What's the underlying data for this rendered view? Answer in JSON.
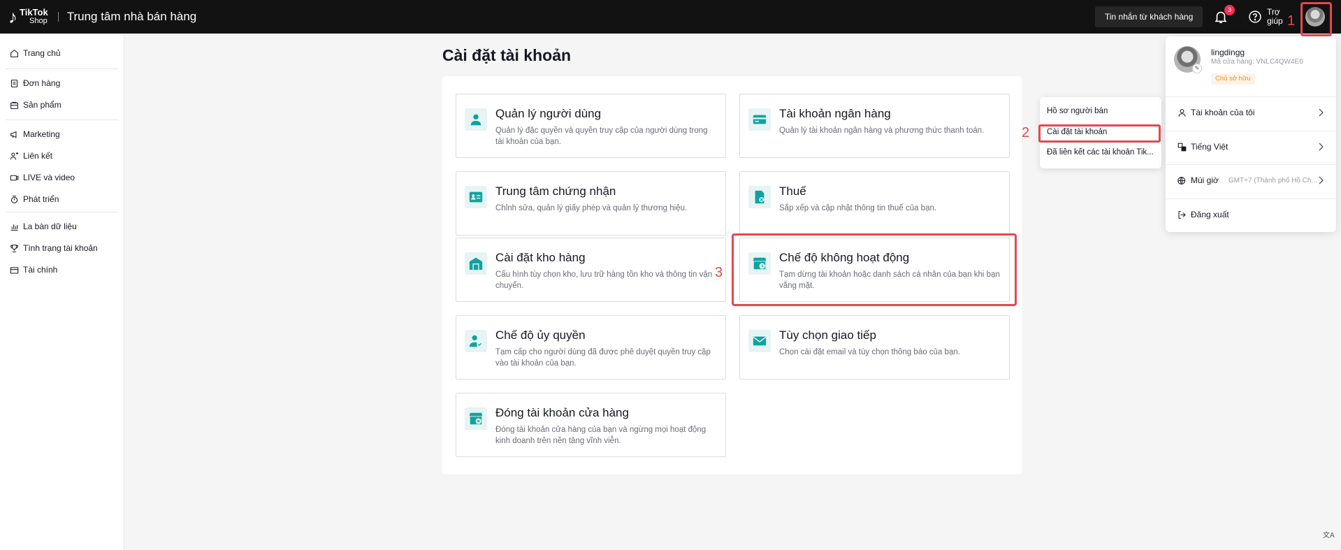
{
  "topbar": {
    "logo_line1": "TikTok",
    "logo_line2": "Shop",
    "title": "Trung tâm nhà bán hàng",
    "messages_button": "Tin nhắn từ khách hàng",
    "notification_count": "3",
    "help_label": "Trợ giúp"
  },
  "annotations": {
    "step1": "1",
    "step2": "2",
    "step3": "3",
    "highlight_color": "#e5484d"
  },
  "sidebar": {
    "items": [
      {
        "label": "Trang chủ",
        "icon": "home-icon"
      },
      {
        "label": "Đơn hàng",
        "icon": "order-icon"
      },
      {
        "label": "Sản phẩm",
        "icon": "product-icon"
      },
      {
        "label": "Marketing",
        "icon": "megaphone-icon"
      },
      {
        "label": "Liên kết",
        "icon": "affiliate-icon"
      },
      {
        "label": "LIVE và video",
        "icon": "video-icon"
      },
      {
        "label": "Phát triển",
        "icon": "growth-icon"
      },
      {
        "label": "La bàn dữ liệu",
        "icon": "chart-icon"
      },
      {
        "label": "Tình trạng tài khoản",
        "icon": "trophy-icon"
      },
      {
        "label": "Tài chính",
        "icon": "wallet-icon"
      }
    ]
  },
  "main": {
    "title": "Cài đặt tài khoản",
    "cards": [
      {
        "title": "Quản lý người dùng",
        "desc": "Quản lý đặc quyền và quyền truy cập của người dùng trong tài khoản của bạn."
      },
      {
        "title": "Tài khoản ngân hàng",
        "desc": "Quản lý tài khoản ngân hàng và phương thức thanh toán."
      },
      {
        "title": "Trung tâm chứng nhận",
        "desc": "Chỉnh sửa, quản lý giấy phép và quản lý thương hiệu."
      },
      {
        "title": "Thuế",
        "desc": "Sắp xếp và cập nhật thông tin thuế của bạn."
      },
      {
        "title": "Cài đặt kho hàng",
        "desc": "Cấu hình tùy chọn kho, lưu trữ hàng tồn kho và thông tin vận chuyển."
      },
      {
        "title": "Chế độ không hoạt động",
        "desc": "Tạm dừng tài khoản hoặc danh sách cá nhân của bạn khi bạn vắng mặt."
      },
      {
        "title": "Chế độ ủy quyền",
        "desc": "Tạm cấp cho người dùng đã được phê duyệt quyền truy cập vào tài khoản của bạn."
      },
      {
        "title": "Tùy chọn giao tiếp",
        "desc": "Chọn cài đặt email và tùy chọn thông báo của bạn."
      },
      {
        "title": "Đóng tài khoản cửa hàng",
        "desc": "Đóng tài khoản cửa hàng của bạn và ngừng mọi hoạt động kinh doanh trên nền tảng vĩnh viễn."
      }
    ],
    "accent": "#0fa3a0"
  },
  "account_menu": {
    "username": "lingdingg",
    "shop_code": "Mã cửa hàng: VNLC4QW4E6",
    "role": "Chủ sở hữu",
    "items": [
      {
        "label": "Tài khoản của tôi"
      },
      {
        "label": "Tiếng Việt"
      },
      {
        "label": "Múi giờ",
        "value": "GMT+7 (Thành phố Hồ Ch..."
      },
      {
        "label": "Đăng xuất"
      }
    ]
  },
  "sub_menu": {
    "items": [
      "Hồ sơ người bán",
      "Cài đặt tài khoản",
      "Đã liên kết các tài khoản Tik..."
    ]
  },
  "translate_badge": "文A"
}
